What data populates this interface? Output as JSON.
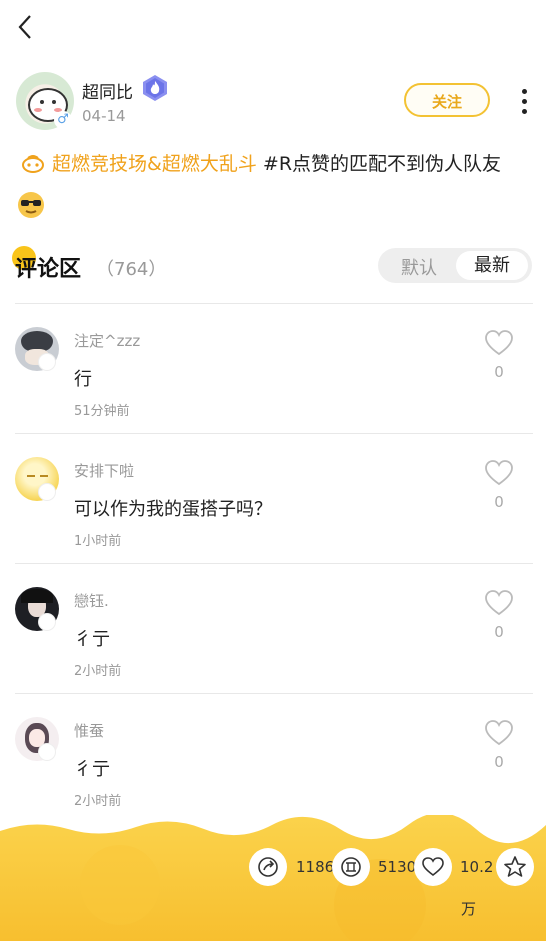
{
  "post": {
    "author": "超同比",
    "date": "04-14",
    "follow_label": "关注",
    "topic": "超燃竞技场&超燃大乱斗",
    "tag_text": "#R点赞的匹配不到伪人队友"
  },
  "comments_section": {
    "title": "评论区",
    "count": "（764）",
    "sort_default": "默认",
    "sort_newest": "最新"
  },
  "comments": [
    {
      "name": "注定^zzz",
      "text": "行",
      "time": "51分钟前",
      "likes": "0"
    },
    {
      "name": "安排下啦",
      "text": "可以作为我的蛋搭子吗？",
      "time": "1小时前",
      "likes": "0"
    },
    {
      "name": "戀钰.",
      "text": "彳亍",
      "time": "2小时前",
      "likes": "0"
    },
    {
      "name": "惟蚕",
      "text": "彳亍",
      "time": "2小时前",
      "likes": "0"
    }
  ],
  "footer": {
    "share_count": "1186",
    "coin_count": "5130",
    "like_count": "10.2",
    "like_unit": "万"
  },
  "icons": {
    "back": "back-arrow-icon",
    "more": "more-vertical-icon",
    "badge": "flame-badge-icon",
    "gender": "male-icon",
    "heart": "heart-icon",
    "share": "share-icon",
    "coin": "coin-icon",
    "star": "star-icon"
  },
  "colors": {
    "accent": "#f3c233",
    "topic": "#f0a21c",
    "footer_bg": "#f9c83a"
  }
}
